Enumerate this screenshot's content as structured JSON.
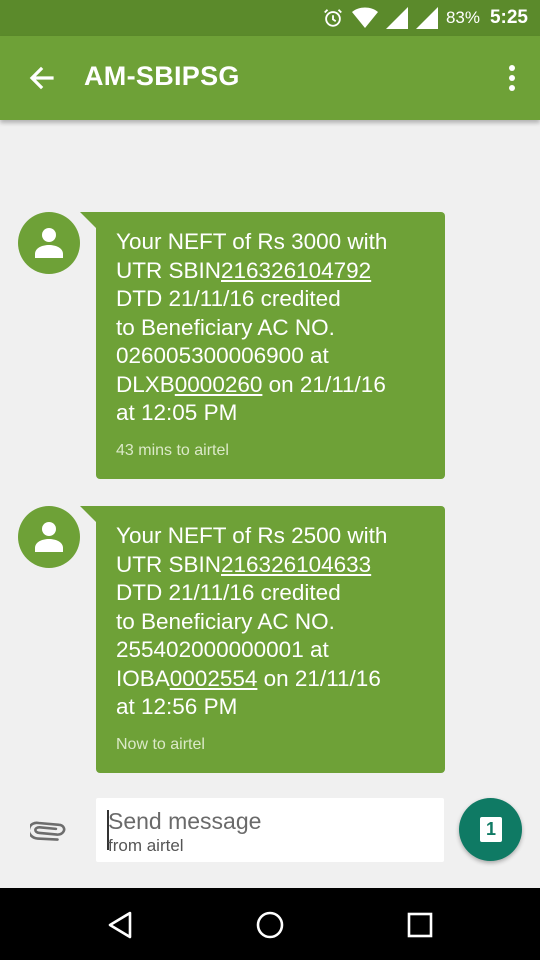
{
  "status_bar": {
    "battery": "83%",
    "time": "5:25",
    "icons": [
      "alarm-icon",
      "wifi-icon",
      "signal-icon",
      "signal-icon"
    ]
  },
  "app_bar": {
    "title": "AM-SBIPSG",
    "icons": [
      "back-arrow-icon",
      "more-vert-icon"
    ]
  },
  "messages": [
    {
      "line1": "Your NEFT of Rs 3000 with",
      "utr_prefix": "UTR SBIN",
      "utr": "216326104792",
      "line3": "DTD 21/11/16 credited",
      "line4": "to Beneficiary AC NO.",
      "line5": "026005300006900 at",
      "ifsc_prefix": "DLXB",
      "ifsc_num": "0000260",
      "date_suffix": " on 21/11/16",
      "line7": "at 12:05 PM",
      "meta": "43 mins to airtel"
    },
    {
      "line1": "Your NEFT of Rs 2500 with",
      "utr_prefix": "UTR SBIN",
      "utr": "216326104633",
      "line3": "DTD 21/11/16 credited",
      "line4": "to Beneficiary AC NO.",
      "line5": "255402000000001 at",
      "ifsc_prefix": "IOBA",
      "ifsc_num": "0002554",
      "date_suffix": " on 21/11/16",
      "line7": "at 12:56 PM",
      "meta": "Now to airtel"
    }
  ],
  "composer": {
    "placeholder": "Send message",
    "sub": "from airtel",
    "send_count": "1"
  },
  "colors": {
    "accent": "#6ea137",
    "status_bar": "#5b8a2b",
    "send_button": "#0f7a64"
  }
}
